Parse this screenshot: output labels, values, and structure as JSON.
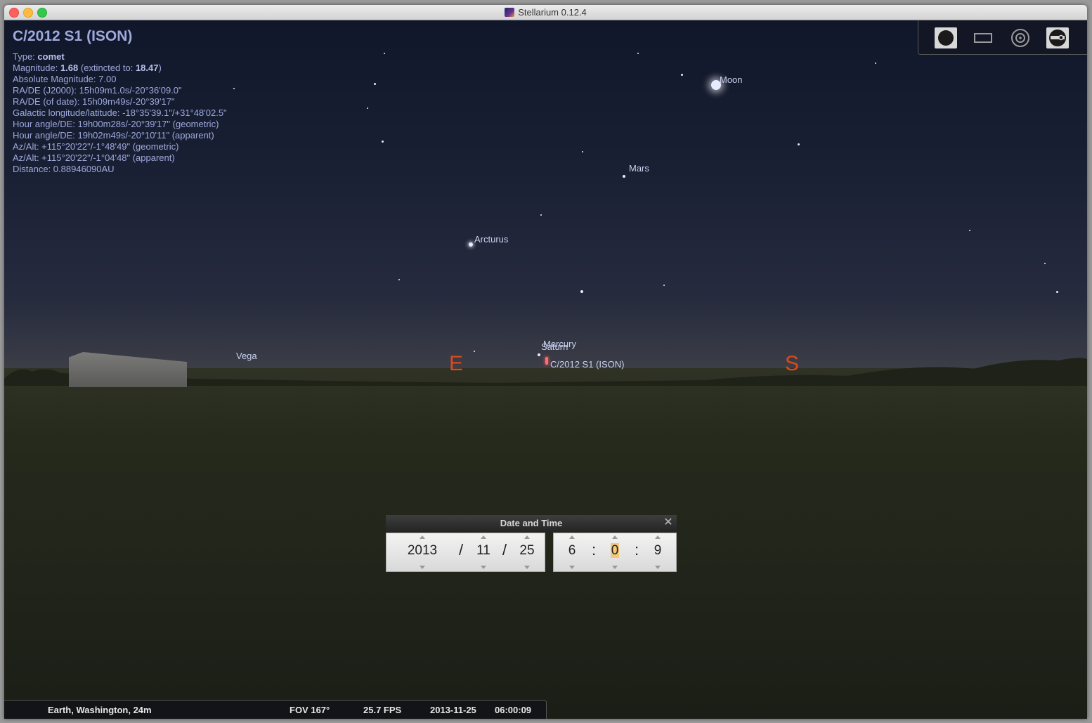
{
  "window": {
    "title": "Stellarium 0.12.4"
  },
  "info_panel": {
    "name": "C/2012 S1 (ISON)",
    "type_label": "Type:",
    "type_value": "comet",
    "magnitude_label": "Magnitude:",
    "magnitude_value": "1.68",
    "extincted_label": "(extincted to:",
    "extincted_value": "18.47",
    "extincted_close": ")",
    "absolute_magnitude": "Absolute Magnitude: 7.00",
    "radec_j2000": "RA/DE (J2000): 15h09m1.0s/-20°36'09.0\"",
    "radec_date": "RA/DE (of date): 15h09m49s/-20°39'17\"",
    "galactic": "Galactic longitude/latitude: -18°35'39.1\"/+31°48'02.5\"",
    "hour_angle_geo": "Hour angle/DE: 19h00m28s/-20°39'17\" (geometric)",
    "hour_angle_app": "Hour angle/DE: 19h02m49s/-20°10'11\" (apparent)",
    "azalt_geo": "Az/Alt: +115°20'22\"/-1°48'49\" (geometric)",
    "azalt_app": "Az/Alt: +115°20'22\"/-1°04'48\" (apparent)",
    "distance": "Distance: 0.88946090AU"
  },
  "sky_labels": {
    "moon": "Moon",
    "mars": "Mars",
    "arcturus": "Arcturus",
    "vega": "Vega",
    "mercury": "Mercury",
    "saturn": "Saturn",
    "comet": "C/2012 S1 (ISON)"
  },
  "cardinals": {
    "east": "E",
    "south": "S"
  },
  "toolbar": {
    "icons": [
      "circle-icon",
      "rectangle-icon",
      "target-icon",
      "telescope-icon"
    ]
  },
  "date_time_dialog": {
    "title": "Date and Time",
    "year": "2013",
    "month": "11",
    "day": "25",
    "hour": "6",
    "minute": "0",
    "second": "9",
    "date_sep": "/",
    "time_sep": ":"
  },
  "status_bar": {
    "location": "Earth, Washington, 24m",
    "fov": "FOV 167°",
    "fps": "25.7 FPS",
    "date": "2013-11-25",
    "time": "06:00:09"
  },
  "colors": {
    "cardinal": "#d94a1c",
    "info_text": "#9ea9dc",
    "highlight_field": "#f5c77a"
  }
}
